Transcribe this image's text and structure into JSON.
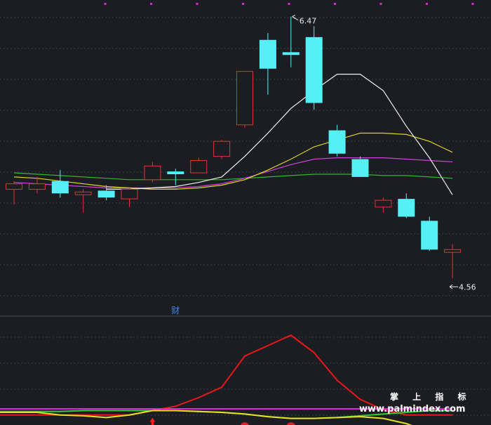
{
  "colors": {
    "background": "#1c1d22",
    "grid": "#3a3d46",
    "up_candle": "#e03434",
    "down_candle": "#54f0f6",
    "ma5": "#f0f0f0",
    "ma10": "#d8d420",
    "ma20": "#d040d8",
    "ma60": "#30b830",
    "ind_red": "#e81818",
    "ind_green": "#2fd02f",
    "ind_yellow": "#e8e020",
    "ind_magenta": "#d828d8"
  },
  "chart_data": [
    {
      "type": "candlestick",
      "price_range": [
        4.3,
        6.55
      ],
      "grid": true,
      "candles": [
        {
          "open": 5.21,
          "close": 5.25,
          "high": 5.27,
          "low": 5.1
        },
        {
          "open": 5.21,
          "close": 5.25,
          "high": 5.3,
          "low": 5.18
        },
        {
          "open": 5.27,
          "close": 5.18,
          "high": 5.35,
          "low": 5.15
        },
        {
          "open": 5.17,
          "close": 5.19,
          "high": 5.21,
          "low": 5.04
        },
        {
          "open": 5.2,
          "close": 5.15,
          "high": 5.24,
          "low": 5.13
        },
        {
          "open": 5.14,
          "close": 5.21,
          "high": 5.22,
          "low": 5.08
        },
        {
          "open": 5.28,
          "close": 5.38,
          "high": 5.41,
          "low": 5.26
        },
        {
          "open": 5.34,
          "close": 5.32,
          "high": 5.36,
          "low": 5.24
        },
        {
          "open": 5.33,
          "close": 5.42,
          "high": 5.44,
          "low": 5.33
        },
        {
          "open": 5.45,
          "close": 5.56,
          "high": 5.57,
          "low": 5.43
        },
        {
          "open": 5.68,
          "close": 6.07,
          "high": 6.07,
          "low": 5.66
        },
        {
          "open": 6.3,
          "close": 6.09,
          "high": 6.35,
          "low": 5.9
        },
        {
          "open": 6.21,
          "close": 6.19,
          "high": 6.47,
          "low": 6.1
        },
        {
          "open": 6.32,
          "close": 5.84,
          "high": 6.4,
          "low": 5.79
        },
        {
          "open": 5.64,
          "close": 5.47,
          "high": 5.68,
          "low": 5.45
        },
        {
          "open": 5.43,
          "close": 5.3,
          "high": 5.45,
          "low": 5.3
        },
        {
          "open": 5.08,
          "close": 5.13,
          "high": 5.15,
          "low": 5.04
        },
        {
          "open": 5.14,
          "close": 5.01,
          "high": 5.18,
          "low": 5.0
        },
        {
          "open": 4.98,
          "close": 4.77,
          "high": 5.01,
          "low": 4.76
        },
        {
          "open": 4.75,
          "close": 4.77,
          "high": 4.81,
          "low": 4.56
        }
      ],
      "ma5": [
        null,
        null,
        null,
        null,
        5.21,
        5.21,
        5.22,
        5.23,
        5.26,
        5.3,
        5.45,
        5.62,
        5.8,
        5.93,
        6.05,
        6.05,
        5.93,
        5.67,
        5.44,
        5.17
      ],
      "ma10": [
        5.3,
        5.29,
        5.27,
        5.25,
        5.23,
        5.22,
        5.21,
        5.21,
        5.22,
        5.24,
        5.28,
        5.35,
        5.43,
        5.52,
        5.57,
        5.62,
        5.62,
        5.61,
        5.56,
        5.48
      ],
      "ma20": [
        5.26,
        5.25,
        5.24,
        5.23,
        5.22,
        5.22,
        5.22,
        5.22,
        5.23,
        5.25,
        5.29,
        5.34,
        5.39,
        5.43,
        5.44,
        5.44,
        5.44,
        5.43,
        5.42,
        5.41
      ],
      "ma60": [
        5.33,
        5.32,
        5.31,
        5.3,
        5.29,
        5.28,
        5.28,
        5.28,
        5.28,
        5.28,
        5.29,
        5.3,
        5.31,
        5.32,
        5.32,
        5.32,
        5.31,
        5.31,
        5.3,
        5.29
      ],
      "annotations": {
        "high": "6.47",
        "low": "4.56",
        "event": "财"
      }
    },
    {
      "type": "line",
      "title": "",
      "y_range": [
        -10,
        110
      ],
      "series": [
        {
          "color_key": "ind_red",
          "values": [
            0,
            0,
            0,
            0,
            0,
            0,
            5,
            10,
            20,
            32,
            68,
            80,
            92,
            72,
            40,
            18,
            6,
            0,
            0,
            0
          ]
        },
        {
          "color_key": "ind_green",
          "values": [
            4,
            4,
            4,
            5,
            5,
            5,
            5,
            5,
            4,
            3,
            1,
            -2,
            -4,
            -4,
            -3,
            -1,
            1,
            3,
            5,
            5
          ]
        },
        {
          "color_key": "ind_yellow",
          "values": [
            3,
            3,
            0,
            -1,
            -3,
            0,
            5,
            5,
            4,
            3,
            1,
            -2,
            -4,
            -4,
            -3,
            -2,
            -4,
            -10,
            -20,
            -23
          ]
        },
        {
          "color_key": "ind_magenta",
          "values": [
            7,
            7,
            7,
            7,
            7,
            7,
            7,
            7,
            7,
            7,
            7,
            7,
            7,
            7,
            7,
            7,
            7,
            7,
            7,
            7
          ]
        }
      ],
      "signals": [
        {
          "index": 6,
          "kind": "buy-arrow"
        },
        {
          "index": 10,
          "kind": "sell-ball"
        },
        {
          "index": 12,
          "kind": "sell-ball"
        }
      ]
    }
  ],
  "watermark": {
    "title": "掌 上 指 标",
    "url": "www.palmindex.com"
  }
}
